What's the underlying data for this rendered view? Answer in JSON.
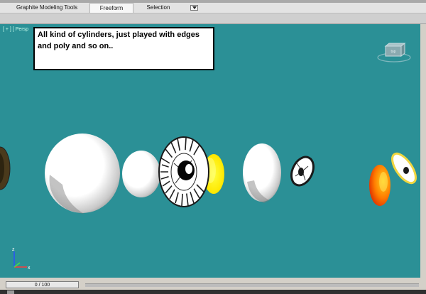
{
  "ribbon": {
    "tabs": [
      {
        "label": "Graphite Modeling Tools"
      },
      {
        "label": "Freeform"
      },
      {
        "label": "Selection"
      }
    ]
  },
  "viewport": {
    "label": "[ + ] [ Persp",
    "comment": "All kind of cylinders, just played with edges and poly and so on..",
    "background_color": "#2b9096",
    "viewcube": {
      "label": "top"
    }
  },
  "axis": {
    "z": "z",
    "x": "x"
  },
  "timeline": {
    "frame_label": "0 / 100"
  }
}
